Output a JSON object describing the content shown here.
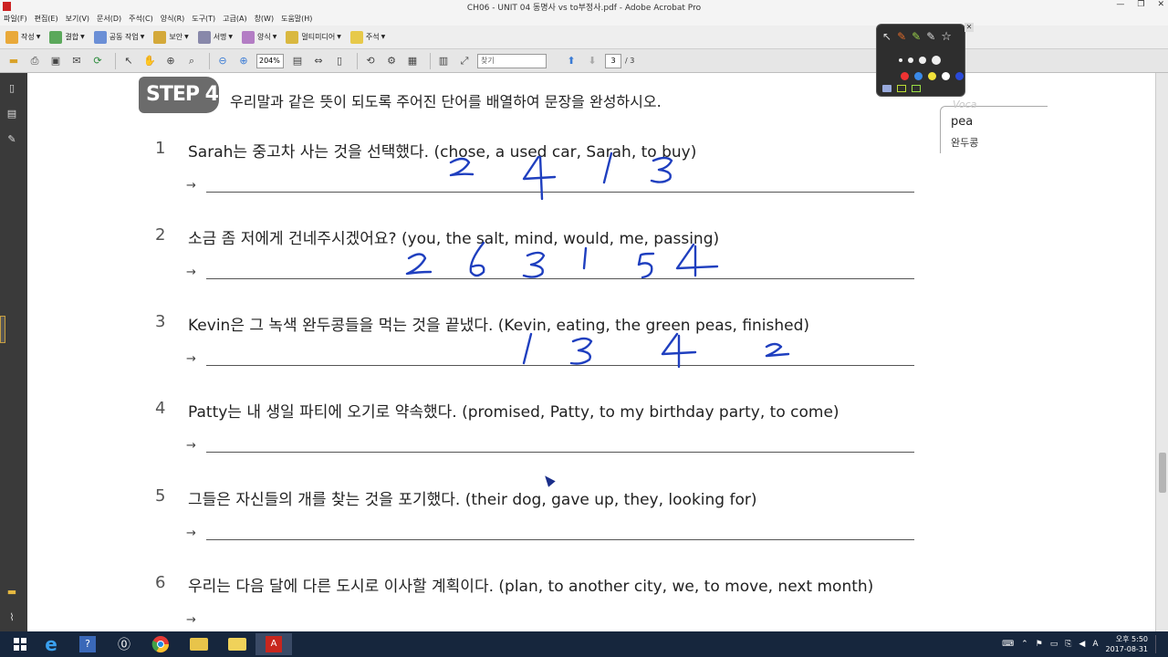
{
  "window": {
    "title": "CH06 - UNIT 04 동명사 vs to부정사.pdf - Adobe Acrobat Pro"
  },
  "menu": [
    "파일(F)",
    "편집(E)",
    "보기(V)",
    "문서(D)",
    "주석(C)",
    "양식(R)",
    "도구(T)",
    "고급(A)",
    "창(W)",
    "도움말(H)"
  ],
  "toolbar": {
    "create": "작성",
    "combine": "결합",
    "collaborate": "공동 작업",
    "secure": "보안",
    "sign": "서명",
    "forms": "양식",
    "multimedia": "멀티미디어",
    "comment": "주석",
    "zoom": "204%",
    "find_placeholder": "찾기",
    "page_current": "3",
    "page_total": "/ 3"
  },
  "doc": {
    "step": "STEP 4",
    "instruction": "우리말과 같은 뜻이 되도록 주어진 단어를 배열하여 문장을 완성하시오.",
    "arrow": "→",
    "items": [
      {
        "num": "1",
        "q": "Sarah는 중고차 사는 것을 선택했다. (chose, a used car, Sarah, to buy)"
      },
      {
        "num": "2",
        "q": "소금 좀 저에게 건네주시겠어요? (you, the salt, mind, would, me, passing)"
      },
      {
        "num": "3",
        "q": "Kevin은 그 녹색 완두콩들을 먹는 것을 끝냈다. (Kevin, eating, the green peas, finished)"
      },
      {
        "num": "4",
        "q": "Patty는 내 생일 파티에 오기로 약속했다. (promised, Patty, to my birthday party, to come)"
      },
      {
        "num": "5",
        "q": "그들은 자신들의 개를 찾는 것을 포기했다. (their dog, gave up, they, looking for)"
      },
      {
        "num": "6",
        "q": "우리는 다음 달에 다른 도시로 이사할 계획이다. (plan, to another city, we, to move, next month)"
      }
    ],
    "handwriting": [
      [
        "2",
        "4",
        "1",
        "3"
      ],
      [
        "2",
        "6",
        "3",
        "1",
        "5",
        "4"
      ],
      [
        "1",
        "3",
        "4",
        "2"
      ]
    ],
    "voca": {
      "head": "Voca",
      "word": "pea",
      "meaning": "완두콩"
    }
  },
  "clock": {
    "time": "오후 5:50",
    "date": "2017-08-31"
  },
  "tray": {
    "ime": "A"
  },
  "colors": {
    "ink": "#1f3fbf",
    "badge": "#6b6b6b"
  }
}
